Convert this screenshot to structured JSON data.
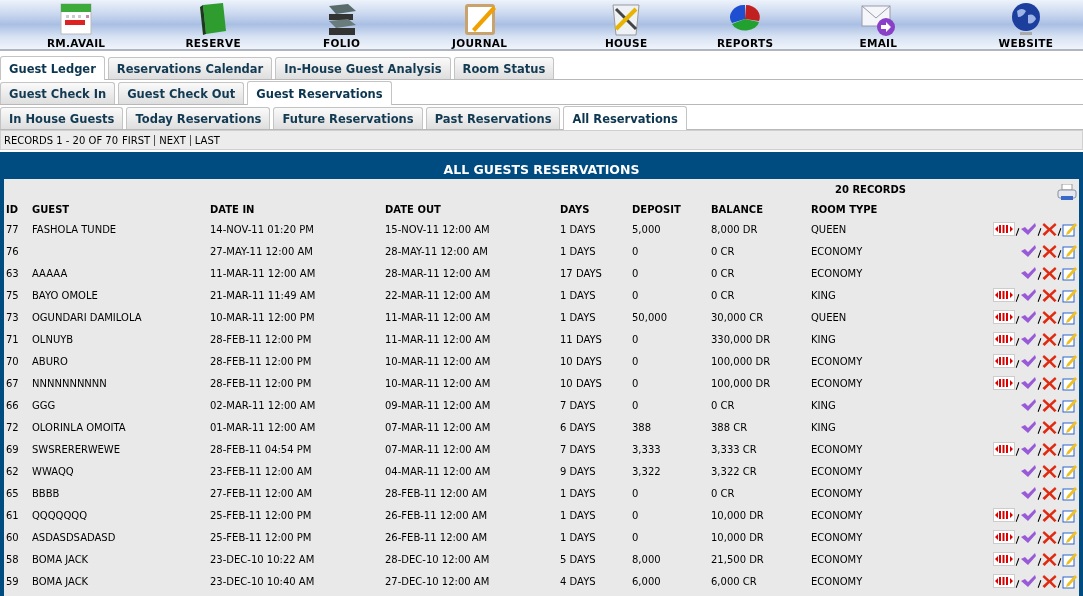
{
  "toolbar": [
    {
      "kind": "calendar",
      "label": "RM.AVAIL"
    },
    {
      "kind": "book",
      "label": "RESERVE"
    },
    {
      "kind": "stack",
      "label": "FOLIO"
    },
    {
      "kind": "notepad",
      "label": "JOURNAL"
    },
    {
      "kind": "tools",
      "label": "HOUSE"
    },
    {
      "kind": "pie",
      "label": "REPORTS"
    },
    {
      "kind": "mail",
      "label": "EMAIL"
    },
    {
      "kind": "globe",
      "label": "WEBSITE"
    }
  ],
  "tabs": [
    {
      "label": "Guest Ledger",
      "selected": true
    },
    {
      "label": "Reservations Calendar",
      "selected": false
    },
    {
      "label": "In-House Guest Analysis",
      "selected": false
    },
    {
      "label": "Room Status",
      "selected": false
    }
  ],
  "subtabs": [
    {
      "label": "Guest Check In",
      "selected": false
    },
    {
      "label": "Guest Check Out",
      "selected": false
    },
    {
      "label": "Guest Reservations",
      "selected": true
    }
  ],
  "view_tabs": [
    {
      "label": "In House Guests",
      "selected": false
    },
    {
      "label": "Today Reservations",
      "selected": false
    },
    {
      "label": "Future Reservations",
      "selected": false
    },
    {
      "label": "Past Reservations",
      "selected": false
    },
    {
      "label": "All Reservations",
      "selected": true
    }
  ],
  "pager": {
    "summary": "RECORDS 1 - 20 OF 70",
    "links": [
      "FIRST",
      "NEXT",
      "LAST"
    ]
  },
  "table": {
    "title": "ALL GUESTS RESERVATIONS",
    "count": "20 RECORDS",
    "columns": [
      "ID",
      "GUEST",
      "DATE IN",
      "DATE OUT",
      "DAYS",
      "DEPOSIT",
      "BALANCE",
      "ROOM TYPE"
    ],
    "rows": [
      {
        "cells": [
          "77",
          "FASHOLA TUNDE",
          "14-NOV-11 01:20 PM",
          "15-NOV-11 12:00 AM",
          "1 DAYS",
          "5,000",
          "8,000 DR",
          "QUEEN"
        ],
        "exit": true
      },
      {
        "cells": [
          "76",
          "",
          "27-MAY-11 12:00 AM",
          "28-MAY-11 12:00 AM",
          "1 DAYS",
          "0",
          "0 CR",
          "ECONOMY"
        ],
        "exit": false
      },
      {
        "cells": [
          "63",
          "AAAAA",
          "11-MAR-11 12:00 AM",
          "28-MAR-11 12:00 AM",
          "17 DAYS",
          "0",
          "0 CR",
          "ECONOMY"
        ],
        "exit": false
      },
      {
        "cells": [
          "75",
          "BAYO OMOLE",
          "21-MAR-11 11:49 AM",
          "22-MAR-11 12:00 AM",
          "1 DAYS",
          "0",
          "0 CR",
          "KING"
        ],
        "exit": true
      },
      {
        "cells": [
          "73",
          "OGUNDARI DAMILOLA",
          "10-MAR-11 12:00 PM",
          "11-MAR-11 12:00 AM",
          "1 DAYS",
          "50,000",
          "30,000 CR",
          "QUEEN"
        ],
        "exit": true
      },
      {
        "cells": [
          "71",
          "OLNUYB",
          "28-FEB-11 12:00 PM",
          "11-MAR-11 12:00 AM",
          "11 DAYS",
          "0",
          "330,000 DR",
          "KING"
        ],
        "exit": true
      },
      {
        "cells": [
          "70",
          "ABURO",
          "28-FEB-11 12:00 PM",
          "10-MAR-11 12:00 AM",
          "10 DAYS",
          "0",
          "100,000 DR",
          "ECONOMY"
        ],
        "exit": true
      },
      {
        "cells": [
          "67",
          "NNNNNNNNNN",
          "28-FEB-11 12:00 PM",
          "10-MAR-11 12:00 AM",
          "10 DAYS",
          "0",
          "100,000 DR",
          "ECONOMY"
        ],
        "exit": true
      },
      {
        "cells": [
          "66",
          "GGG",
          "02-MAR-11 12:00 AM",
          "09-MAR-11 12:00 AM",
          "7 DAYS",
          "0",
          "0 CR",
          "KING"
        ],
        "exit": false
      },
      {
        "cells": [
          "72",
          "OLORINLA OMOITA",
          "01-MAR-11 12:00 AM",
          "07-MAR-11 12:00 AM",
          "6 DAYS",
          "388",
          "388 CR",
          "KING"
        ],
        "exit": false
      },
      {
        "cells": [
          "69",
          "SWSRERERWEWE",
          "28-FEB-11 04:54 PM",
          "07-MAR-11 12:00 AM",
          "7 DAYS",
          "3,333",
          "3,333 CR",
          "ECONOMY"
        ],
        "exit": true
      },
      {
        "cells": [
          "62",
          "WWAQQ",
          "23-FEB-11 12:00 AM",
          "04-MAR-11 12:00 AM",
          "9 DAYS",
          "3,322",
          "3,322 CR",
          "ECONOMY"
        ],
        "exit": false
      },
      {
        "cells": [
          "65",
          "BBBB",
          "27-FEB-11 12:00 AM",
          "28-FEB-11 12:00 AM",
          "1 DAYS",
          "0",
          "0 CR",
          "ECONOMY"
        ],
        "exit": false
      },
      {
        "cells": [
          "61",
          "QQQQQQQ",
          "25-FEB-11 12:00 PM",
          "26-FEB-11 12:00 AM",
          "1 DAYS",
          "0",
          "10,000 DR",
          "ECONOMY"
        ],
        "exit": true
      },
      {
        "cells": [
          "60",
          "ASDASDSADASD",
          "25-FEB-11 12:00 PM",
          "26-FEB-11 12:00 AM",
          "1 DAYS",
          "0",
          "10,000 DR",
          "ECONOMY"
        ],
        "exit": true
      },
      {
        "cells": [
          "58",
          "BOMA JACK",
          "23-DEC-10 10:22 AM",
          "28-DEC-10 12:00 AM",
          "5 DAYS",
          "8,000",
          "21,500 DR",
          "ECONOMY"
        ],
        "exit": true
      },
      {
        "cells": [
          "59",
          "BOMA JACK",
          "23-DEC-10 10:40 AM",
          "27-DEC-10 12:00 AM",
          "4 DAYS",
          "6,000",
          "6,000 CR",
          "ECONOMY"
        ],
        "exit": true
      }
    ]
  }
}
